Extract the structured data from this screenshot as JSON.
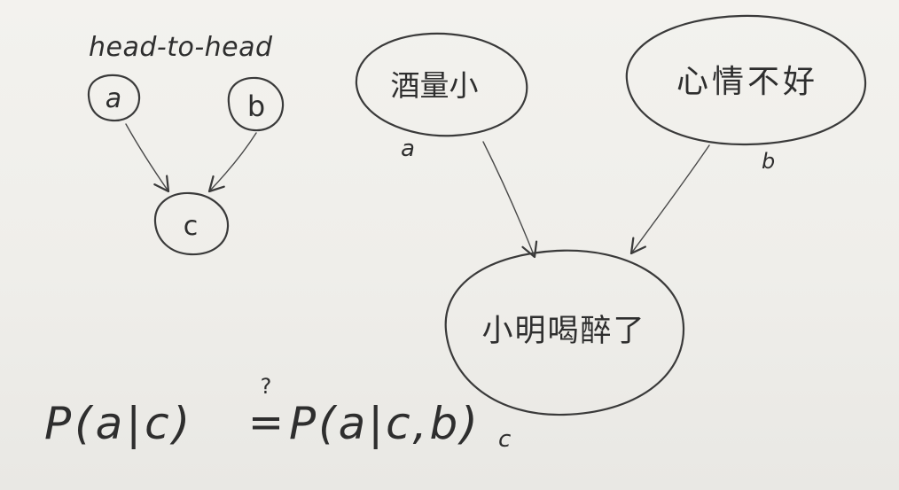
{
  "small_diagram": {
    "title": "head-to-head",
    "nodes": {
      "a": "a",
      "b": "b",
      "c": "c"
    }
  },
  "example_diagram": {
    "nodes": {
      "a": {
        "text": "酒量小",
        "var": "a"
      },
      "b": {
        "text": "心情不好",
        "var": "b"
      },
      "c": {
        "text": "小明喝醉了",
        "var": "c"
      }
    }
  },
  "formula": {
    "left": "P(a|c)",
    "relation": "=",
    "question_mark": "?",
    "right": "P(a|c,b)"
  }
}
